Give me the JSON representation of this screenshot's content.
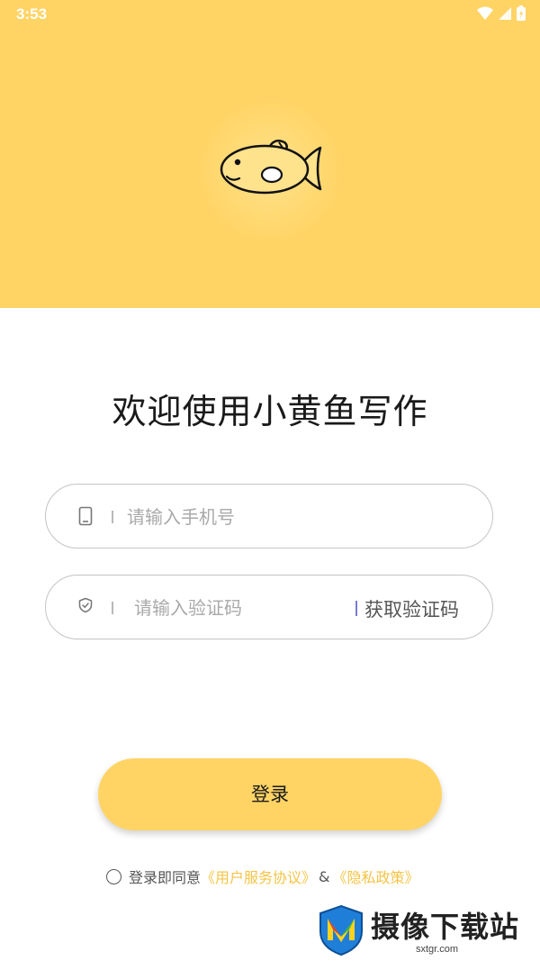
{
  "status_bar": {
    "time": "3:53"
  },
  "colors": {
    "brand_yellow": "#FFD465",
    "link_yellow": "#F5C445"
  },
  "welcome": {
    "title": "欢迎使用小黄鱼写作"
  },
  "phone_field": {
    "placeholder": "请输入手机号",
    "value": "",
    "icon": "phone-icon"
  },
  "code_field": {
    "placeholder": "请输入验证码",
    "value": "",
    "icon": "shield-icon",
    "get_code_label": "获取验证码"
  },
  "login": {
    "label": "登录"
  },
  "agreement": {
    "prefix": "登录即同意",
    "terms_link": "《用户服务协议》",
    "amp": "&",
    "privacy_link": "《隐私政策》"
  },
  "watermark": {
    "title": "摄像下载站",
    "url": "sxtgr.com"
  }
}
